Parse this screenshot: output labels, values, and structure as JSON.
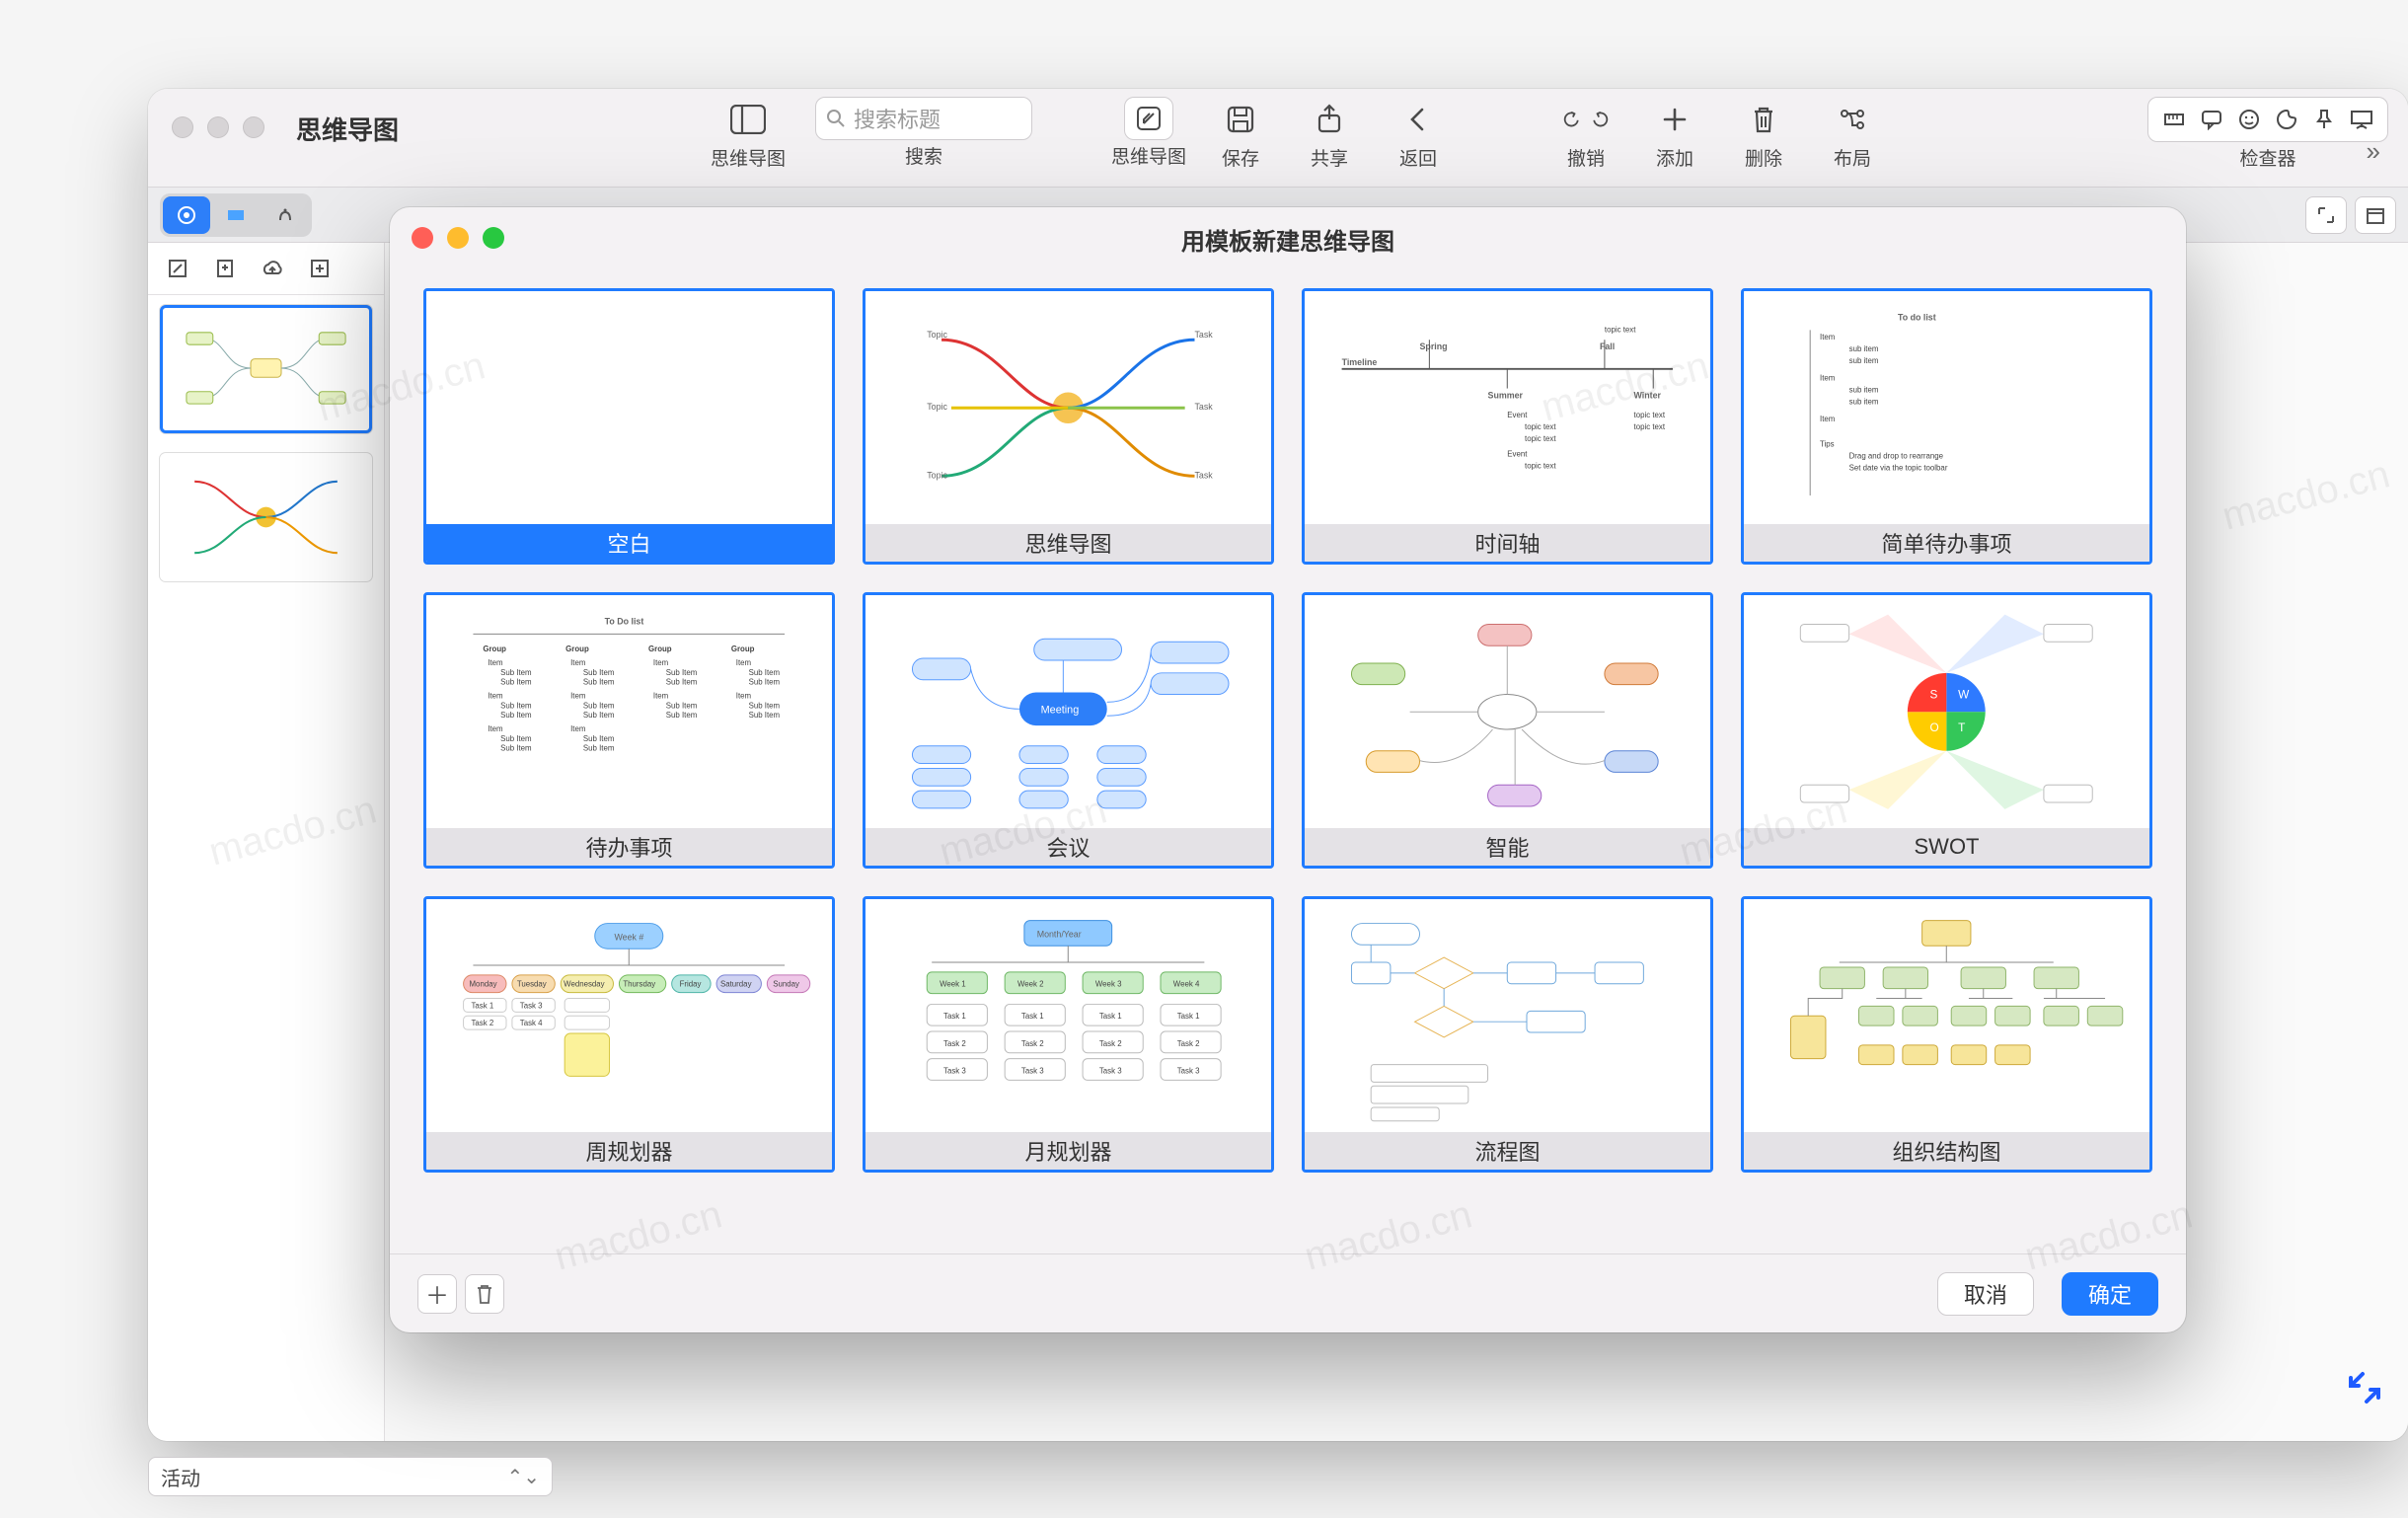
{
  "window": {
    "title": "思维导图",
    "toolbar": {
      "sidebar_toggle": "思维导图",
      "search_placeholder": "搜索标题",
      "search_label": "搜索",
      "mindmap": "思维导图",
      "save": "保存",
      "share": "共享",
      "back": "返回",
      "undo": "撤销",
      "add": "添加",
      "delete": "删除",
      "layout": "布局",
      "inspector": "检查器"
    }
  },
  "sidebar": {
    "thumbs": [
      {
        "id": "doc1",
        "selected": true
      },
      {
        "id": "doc2",
        "selected": false
      }
    ]
  },
  "activity_select": {
    "value": "活动"
  },
  "dialog": {
    "title": "用模板新建思维导图",
    "templates": [
      {
        "key": "blank",
        "label": "空白",
        "selected": true
      },
      {
        "key": "mindmap",
        "label": "思维导图",
        "selected": false
      },
      {
        "key": "timeline",
        "label": "时间轴",
        "selected": false
      },
      {
        "key": "simpletodo",
        "label": "简单待办事项",
        "selected": false
      },
      {
        "key": "todo",
        "label": "待办事项",
        "selected": false
      },
      {
        "key": "meeting",
        "label": "会议",
        "selected": false
      },
      {
        "key": "smart",
        "label": "智能",
        "selected": false
      },
      {
        "key": "swot",
        "label": "SWOT",
        "selected": false
      },
      {
        "key": "week",
        "label": "周规划器",
        "selected": false
      },
      {
        "key": "month",
        "label": "月规划器",
        "selected": false
      },
      {
        "key": "flow",
        "label": "流程图",
        "selected": false
      },
      {
        "key": "org",
        "label": "组织结构图",
        "selected": false
      }
    ],
    "footer": {
      "cancel": "取消",
      "ok": "确定"
    }
  },
  "watermark_text": "macdo.cn"
}
